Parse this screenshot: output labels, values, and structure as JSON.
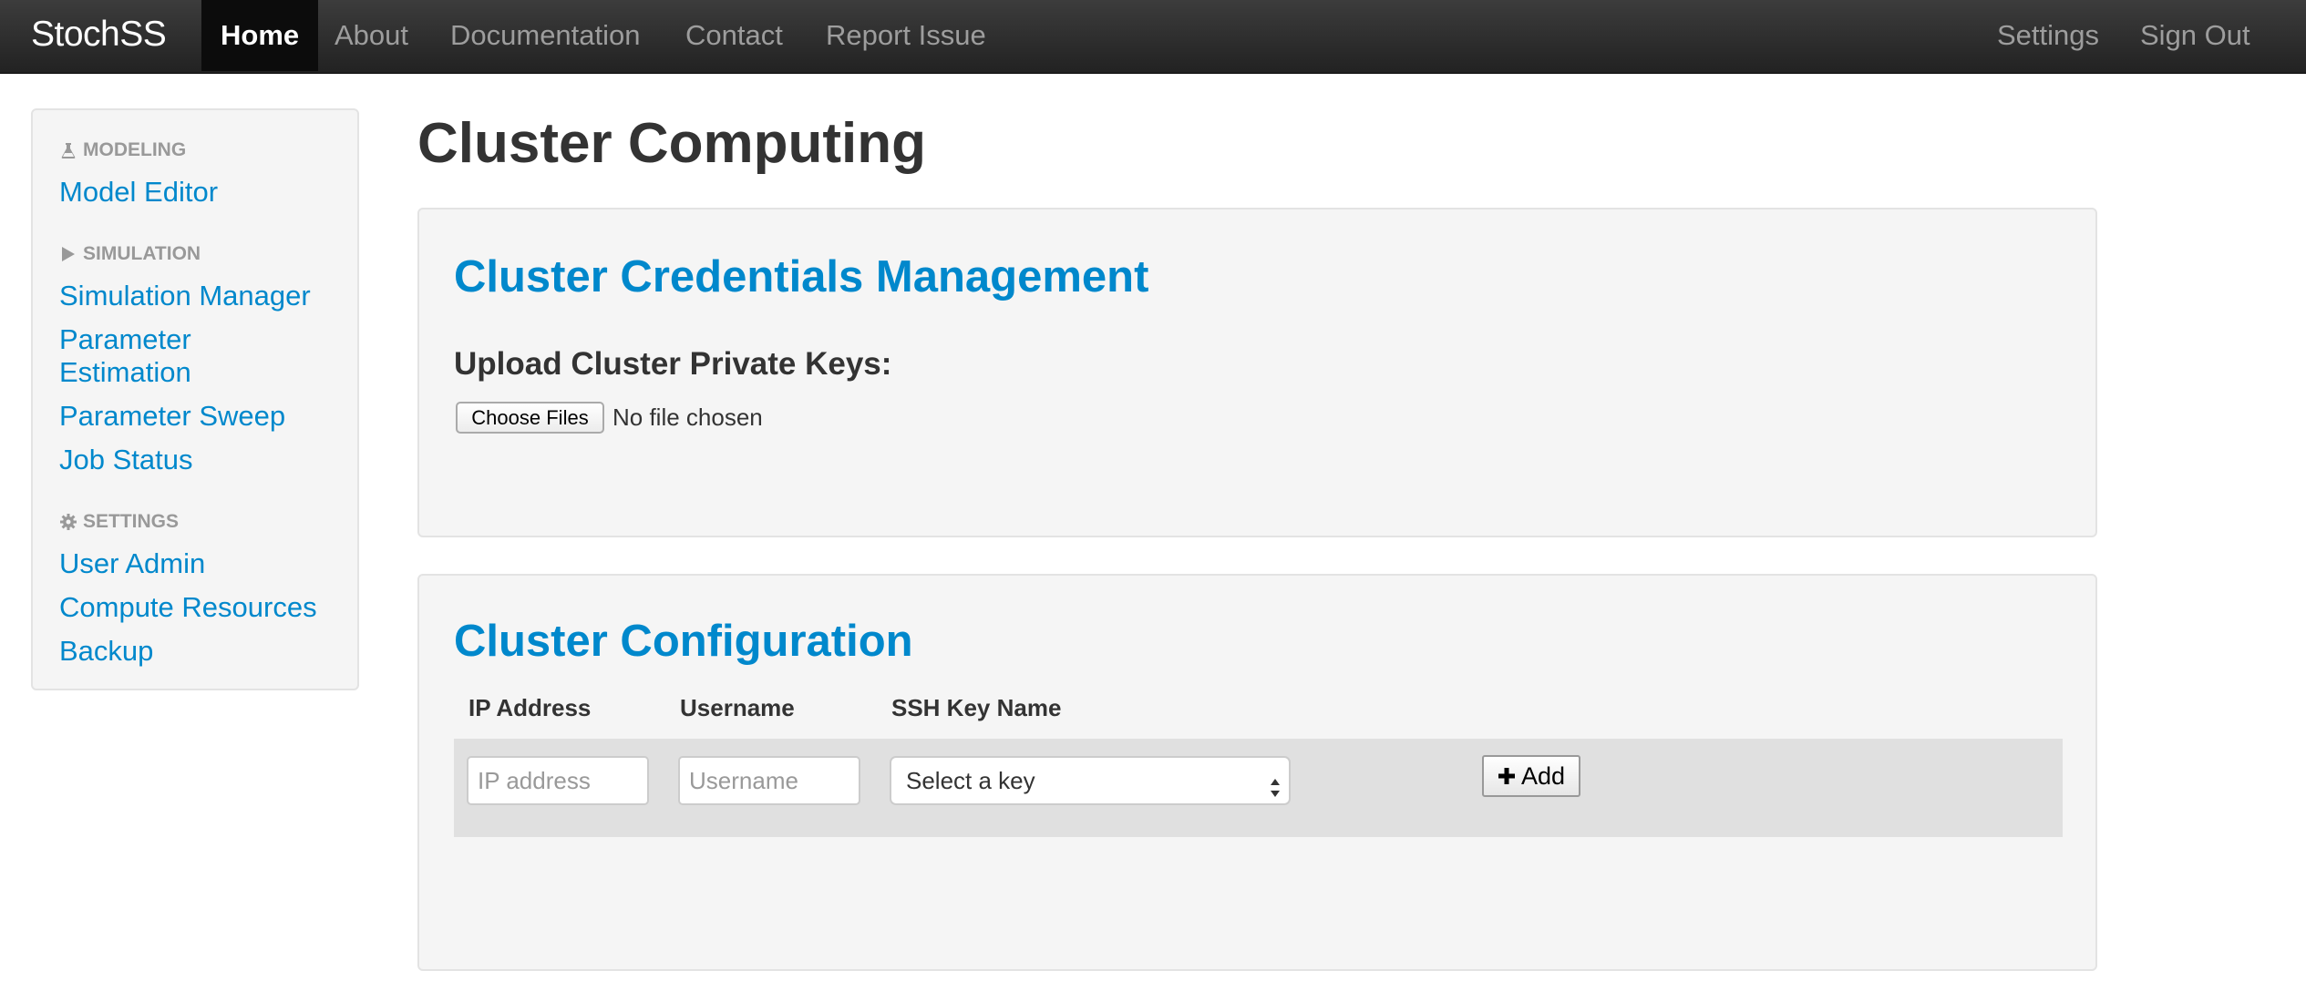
{
  "navbar": {
    "brand": "StochSS",
    "left_items": [
      {
        "label": "Home",
        "active": true
      },
      {
        "label": "About"
      },
      {
        "label": "Documentation"
      },
      {
        "label": "Contact"
      },
      {
        "label": "Report Issue"
      }
    ],
    "right_items": [
      {
        "label": "Settings"
      },
      {
        "label": "Sign Out"
      }
    ]
  },
  "sidebar": {
    "sections": [
      {
        "header": "MODELING",
        "icon": "flask-icon",
        "links": [
          "Model Editor"
        ]
      },
      {
        "header": "SIMULATION",
        "icon": "play-icon",
        "links": [
          "Simulation Manager",
          "Parameter Estimation",
          "Parameter Sweep",
          "Job Status"
        ]
      },
      {
        "header": "SETTINGS",
        "icon": "gear-icon",
        "links": [
          "User Admin",
          "Compute Resources",
          "Backup"
        ]
      }
    ],
    "parameter_estimation_lines": [
      "Parameter",
      "Estimation"
    ]
  },
  "main": {
    "page_title": "Cluster Computing",
    "credentials": {
      "title": "Cluster Credentials Management",
      "upload_label": "Upload Cluster Private Keys:",
      "file_button": "Choose Files",
      "file_status": "No file chosen"
    },
    "config": {
      "title": "Cluster Configuration",
      "columns": [
        "IP Address",
        "Username",
        "SSH Key Name"
      ],
      "ip_placeholder": "IP address",
      "username_placeholder": "Username",
      "key_select_value": "Select a key",
      "add_button": "Add"
    }
  },
  "colors": {
    "link": "#0088cc",
    "navbar": "#222222",
    "panel": "#f5f5f5"
  }
}
